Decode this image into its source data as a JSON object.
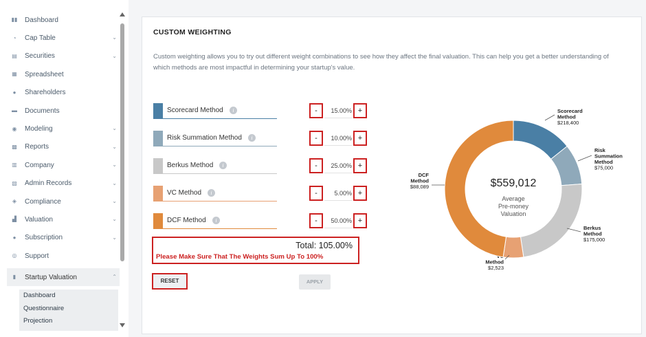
{
  "sidebar": {
    "items": [
      {
        "label": "Dashboard",
        "icon": "dashboard-icon",
        "glyph": "▮▮",
        "chevron": false
      },
      {
        "label": "Cap Table",
        "icon": "pie-icon",
        "glyph": "◔",
        "chevron": true
      },
      {
        "label": "Securities",
        "icon": "securities-icon",
        "glyph": "▤",
        "chevron": true
      },
      {
        "label": "Spreadsheet",
        "icon": "spreadsheet-icon",
        "glyph": "▦",
        "chevron": false
      },
      {
        "label": "Shareholders",
        "icon": "user-icon",
        "glyph": "●",
        "chevron": false
      },
      {
        "label": "Documents",
        "icon": "documents-icon",
        "glyph": "▬",
        "chevron": false
      },
      {
        "label": "Modeling",
        "icon": "bulb-icon",
        "glyph": "◉",
        "chevron": true
      },
      {
        "label": "Reports",
        "icon": "reports-icon",
        "glyph": "▩",
        "chevron": true
      },
      {
        "label": "Company",
        "icon": "company-icon",
        "glyph": "▥",
        "chevron": true
      },
      {
        "label": "Admin Records",
        "icon": "admin-records-icon",
        "glyph": "▧",
        "chevron": true
      },
      {
        "label": "Compliance",
        "icon": "shield-icon",
        "glyph": "◈",
        "chevron": true
      },
      {
        "label": "Valuation",
        "icon": "chart-icon",
        "glyph": "▟",
        "chevron": true
      },
      {
        "label": "Subscription",
        "icon": "dollar-icon",
        "glyph": "●",
        "chevron": true
      },
      {
        "label": "Support",
        "icon": "support-icon",
        "glyph": "◎",
        "chevron": false
      }
    ],
    "active": {
      "label": "Startup Valuation",
      "icon": "document-icon",
      "glyph": "▮",
      "chevron": "⌃"
    },
    "sub_items": [
      "Dashboard",
      "Questionnaire",
      "Projection"
    ]
  },
  "panel": {
    "title": "CUSTOM WEIGHTING",
    "description": "Custom weighting allows you to try out different weight combinations to see how they affect the final valuation. This can help you get a better understanding of which methods are most impactful in determining your startup's value.",
    "methods": [
      {
        "label": "Scorecard Method",
        "weight": "15.00%",
        "color": "#4a7fa5"
      },
      {
        "label": "Risk Summation Method",
        "weight": "10.00%",
        "color": "#8fa9ba"
      },
      {
        "label": "Berkus Method",
        "weight": "25.00%",
        "color": "#c8c8c8"
      },
      {
        "label": "VC Method",
        "weight": "5.00%",
        "color": "#e7a173"
      },
      {
        "label": "DCF Method",
        "weight": "50.00%",
        "color": "#e08a3c"
      }
    ],
    "minus_label": "-",
    "plus_label": "+",
    "info_glyph": "i",
    "total": "Total: 105.00%",
    "warning": "Please Make Sure That The Weights Sum Up To 100%",
    "reset_label": "RESET",
    "apply_label": "APPLY",
    "center_value": "$559,012",
    "center_caption": [
      "Average",
      "Pre-money",
      "Valuation"
    ]
  },
  "chart_data": {
    "type": "pie",
    "center_label": "$559,012 Average Pre-money Valuation",
    "slices": [
      {
        "name": "Scorecard Method",
        "value": 218400,
        "value_label": "$218,400",
        "weight": 15,
        "color": "#4a7fa5",
        "label_lines": [
          "Scorecard",
          "Method"
        ]
      },
      {
        "name": "Risk Summation Method",
        "value": 75000,
        "value_label": "$75,000",
        "weight": 10,
        "color": "#8fa9ba",
        "label_lines": [
          "Risk",
          "Summation",
          "Method"
        ]
      },
      {
        "name": "Berkus Method",
        "value": 175000,
        "value_label": "$175,000",
        "weight": 25,
        "color": "#c8c8c8",
        "label_lines": [
          "Berkus",
          "Method"
        ]
      },
      {
        "name": "VC Method",
        "value": 2523,
        "value_label": "$2,523",
        "weight": 5,
        "color": "#e7a173",
        "label_lines": [
          "VC",
          "Method"
        ]
      },
      {
        "name": "DCF Method",
        "value": 88089,
        "value_label": "$88,089",
        "weight": 50,
        "color": "#e08a3c",
        "label_lines": [
          "DCF",
          "Method"
        ]
      }
    ]
  }
}
